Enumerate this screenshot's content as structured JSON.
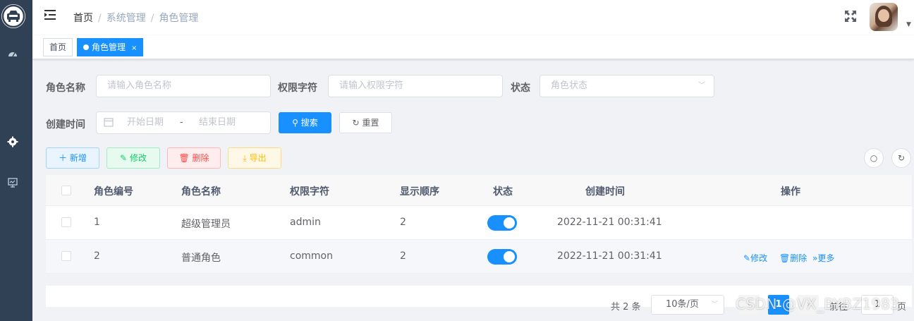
{
  "navbar": {
    "breadcrumb": [
      "首页",
      "系统管理",
      "角色管理"
    ],
    "separator": "/"
  },
  "tags": {
    "home": "首页",
    "active": "角色管理",
    "close": "×"
  },
  "search": {
    "role_name_label": "角色名称",
    "role_name_placeholder": "请输入角色名称",
    "role_key_label": "权限字符",
    "role_key_placeholder": "请输入权限字符",
    "status_label": "状态",
    "status_placeholder": "角色状态",
    "create_time_label": "创建时间",
    "start_placeholder": "开始日期",
    "range_sep": "-",
    "end_placeholder": "结束日期",
    "search_button": "搜索",
    "reset_button": "重置"
  },
  "toolbar": {
    "add": "新增",
    "edit": "修改",
    "delete": "删除",
    "export": "导出"
  },
  "table": {
    "headers": [
      "角色编号",
      "角色名称",
      "权限字符",
      "显示顺序",
      "状态",
      "创建时间",
      "操作"
    ],
    "rows": [
      {
        "id": "1",
        "name": "超级管理员",
        "key": "admin",
        "sort": "2",
        "status": true,
        "created": "2022-11-21 00:31:41",
        "ops": []
      },
      {
        "id": "2",
        "name": "普通角色",
        "key": "common",
        "sort": "2",
        "status": true,
        "created": "2022-11-21 00:31:41",
        "ops": [
          "修改",
          "删除",
          "更多"
        ]
      }
    ]
  },
  "pagination": {
    "total": "共 2 条",
    "page_size": "10条/页",
    "current": "1",
    "goto_label": "前往",
    "goto_value": "1",
    "page_unit": "页"
  },
  "watermark": "CSDN @VX_BYBZ1983",
  "colors": {
    "primary": "#1890ff",
    "sidebar": "#304156"
  }
}
